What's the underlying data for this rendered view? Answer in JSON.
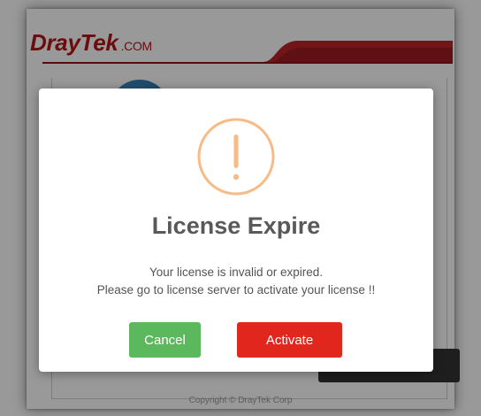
{
  "background": {
    "logo_main": "DrayTek",
    "logo_suffix": ".COM",
    "copyright": "Copyright © DrayTek Corp"
  },
  "dialog": {
    "icon": "exclamation-circle-icon",
    "title": "License Expire",
    "message_line1": "Your license is invalid or expired.",
    "message_line2": "Please go to license server to activate your license !!",
    "cancel_label": "Cancel",
    "activate_label": "Activate"
  },
  "colors": {
    "brand_red": "#b31417",
    "icon_orange": "#f8bb86",
    "cancel_green": "#5cb85c",
    "activate_red": "#e0261d"
  }
}
